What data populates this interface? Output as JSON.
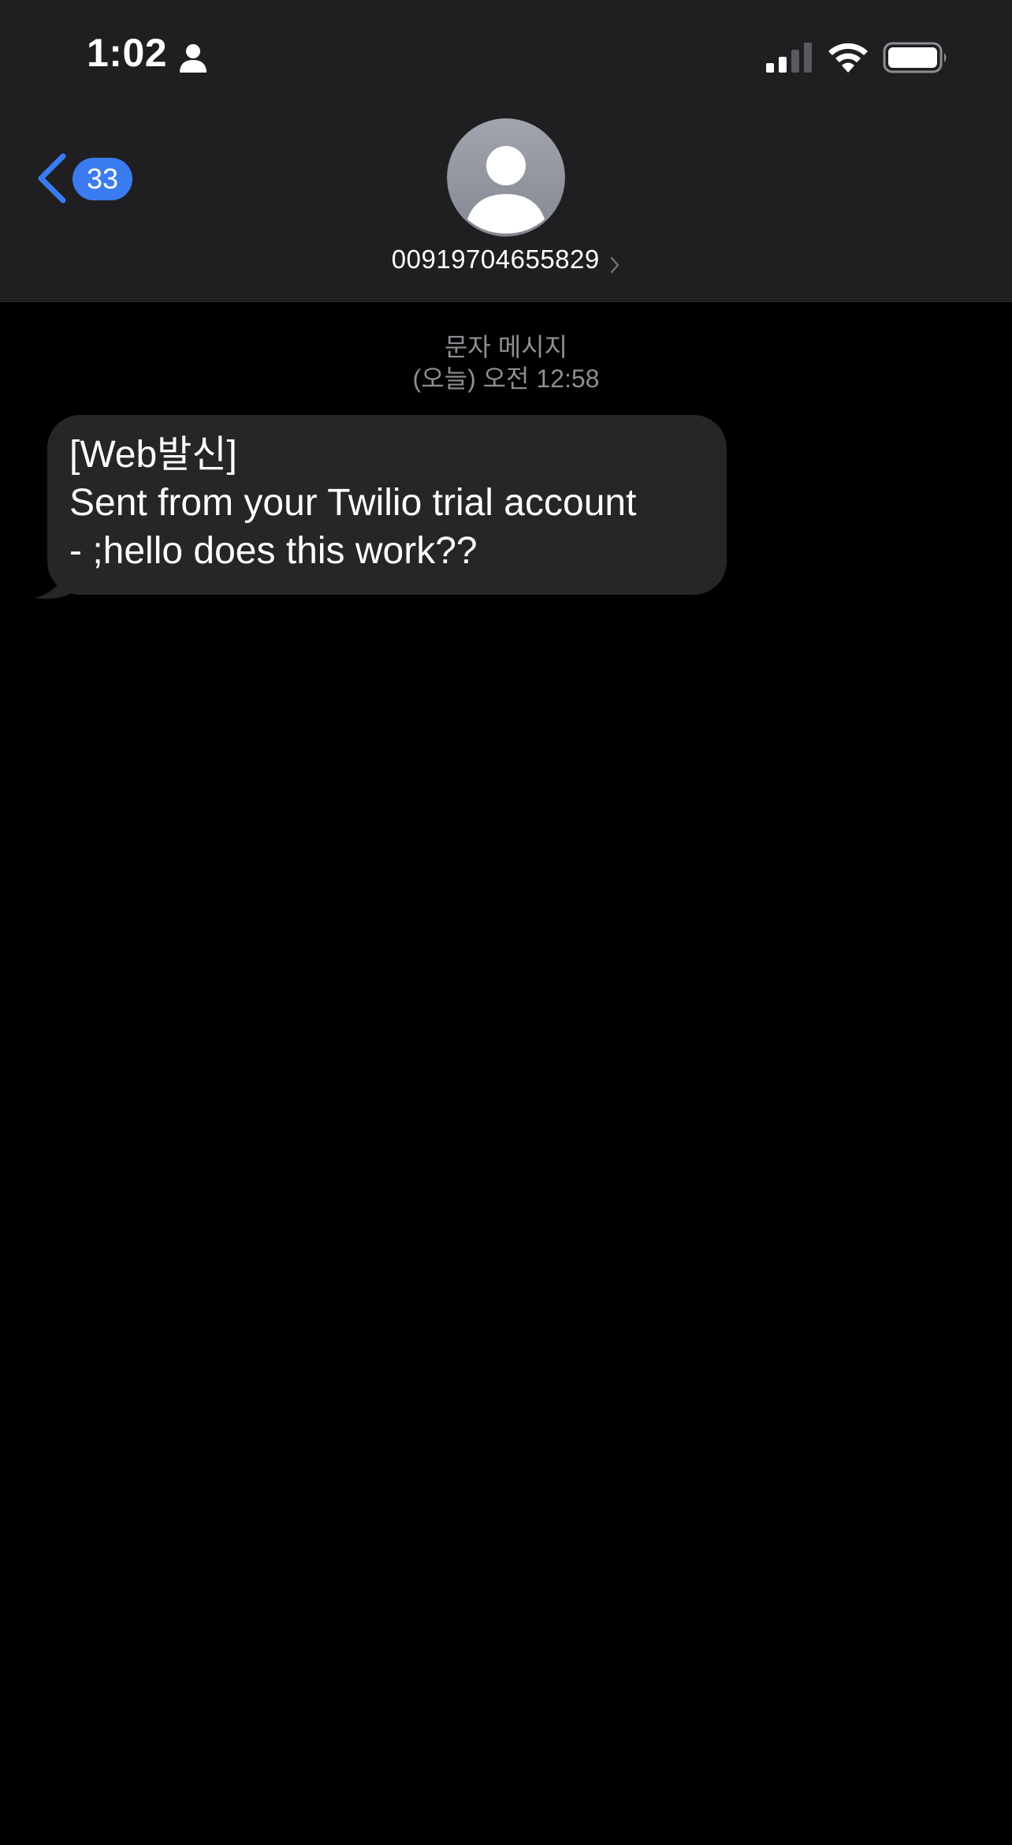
{
  "status_bar": {
    "time": "1:02",
    "person_icon": "person-icon",
    "signal_icon": "cellular-signal-icon",
    "wifi_icon": "wifi-icon",
    "battery_icon": "battery-icon"
  },
  "header": {
    "back_badge_count": "33",
    "contact_name": "00919704655829",
    "avatar_icon": "default-avatar-icon",
    "accent_color": "#3a7bf0"
  },
  "conversation": {
    "service_label": "문자 메시지",
    "timestamp": "(오늘) 오전 12:58",
    "messages": [
      {
        "direction": "incoming",
        "lines": [
          "[Web발신]",
          "Sent from your Twilio trial account",
          "- ;hello does this work??"
        ]
      }
    ]
  }
}
